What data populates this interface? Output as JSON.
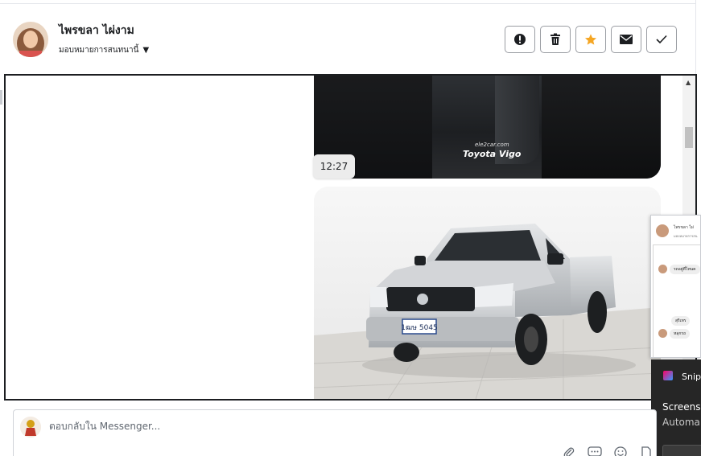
{
  "header": {
    "contact_name": "ไพรขลา ไผ่งาม",
    "assign_label": "มอบหมายการสนทนานี้"
  },
  "chat": {
    "messages": [
      {
        "type": "image",
        "watermark_site": "ele2car.com",
        "watermark_title": "Toyota Vigo"
      },
      {
        "type": "timestamp",
        "time": "12:27"
      },
      {
        "type": "image",
        "license_plate": "1ฒษ 5045"
      }
    ]
  },
  "preview": {
    "name": "ไพรขลา ไผ่",
    "sub": "มอบหมายการสน",
    "bubbles": [
      "รถอยู่ที่ไหนค",
      "สุริเทร",
      "หลุกรถ"
    ]
  },
  "toast": {
    "app": "Snip",
    "title": "Screens",
    "subtitle": "Automa"
  },
  "composer": {
    "placeholder": "ตอบกลับใน Messenger..."
  },
  "colors": {
    "star": "#f5a623",
    "border": "#1c1e21"
  }
}
